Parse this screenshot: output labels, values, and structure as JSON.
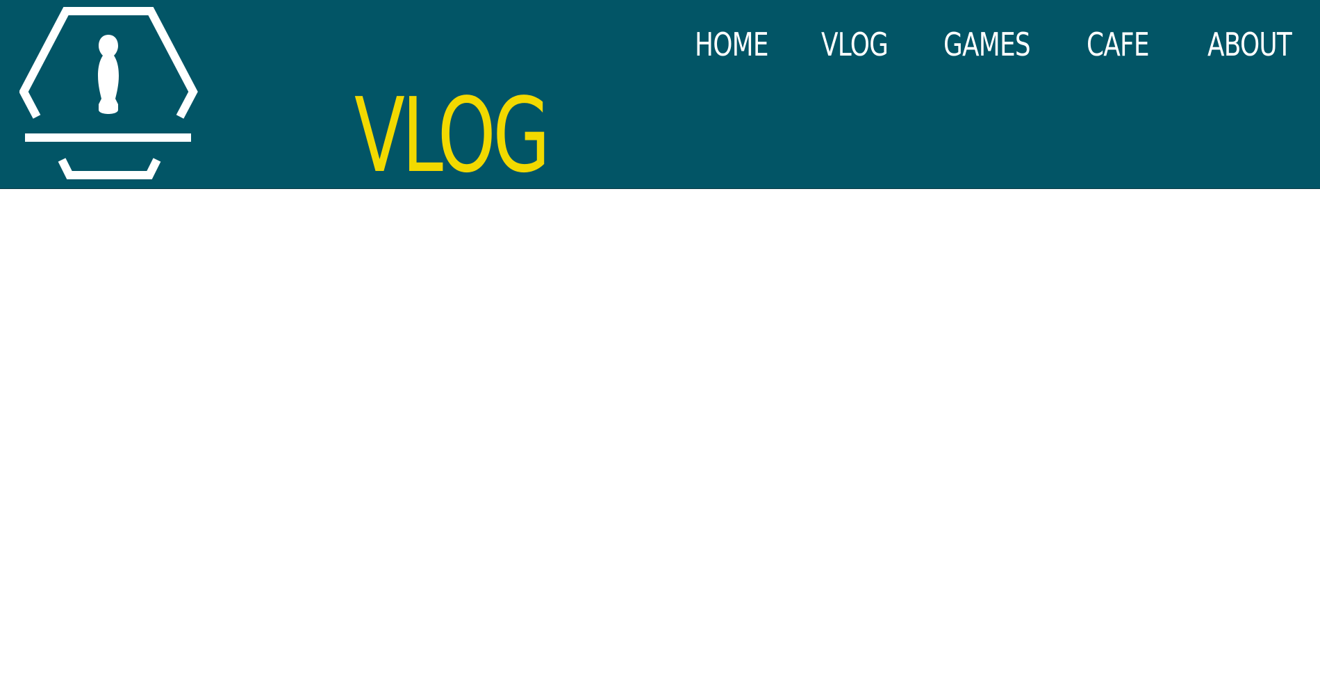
{
  "header": {
    "logo_icon": "board-game-pawn-hexagon-logo",
    "colors": {
      "background": "#025566",
      "nav_text": "#ffffff",
      "title_text": "#f2d900",
      "logo_stroke": "#ffffff"
    }
  },
  "nav": {
    "items": [
      {
        "label": "HOME"
      },
      {
        "label": "VLOG"
      },
      {
        "label": "GAMES"
      },
      {
        "label": "CAFE"
      },
      {
        "label": "ABOUT"
      }
    ]
  },
  "page": {
    "title": "VLOG"
  }
}
